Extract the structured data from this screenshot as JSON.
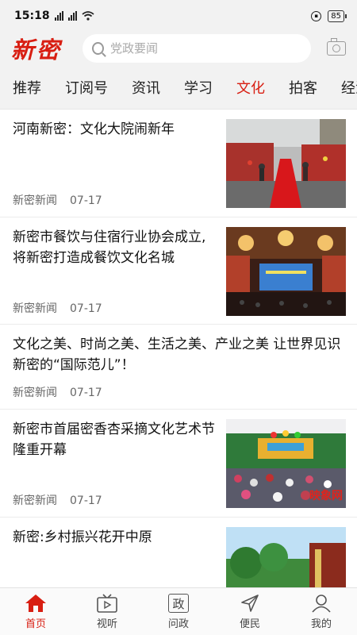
{
  "status_bar": {
    "time": "15:18",
    "battery": "85"
  },
  "header": {
    "logo": "新密",
    "search_placeholder": "党政要闻"
  },
  "tabs": [
    {
      "label": "推荐"
    },
    {
      "label": "订阅号"
    },
    {
      "label": "资讯"
    },
    {
      "label": "学习"
    },
    {
      "label": "文化"
    },
    {
      "label": "拍客"
    },
    {
      "label": "经济"
    }
  ],
  "active_tab": "文化",
  "articles": [
    {
      "title": "河南新密：文化大院闹新年",
      "source": "新密新闻",
      "date": "07-17"
    },
    {
      "title": "新密市餐饮与住宿行业协会成立,将新密打造成餐饮文化名城",
      "source": "新密新闻",
      "date": "07-17"
    },
    {
      "title": "文化之美、时尚之美、生活之美、产业之美 让世界见识新密的“国际范儿”！",
      "source": "新密新闻",
      "date": "07-17"
    },
    {
      "title": "新密市首届密香杏采摘文化艺术节隆重开幕",
      "source": "新密新闻",
      "date": "07-17",
      "watermark": "映象网"
    },
    {
      "title": "新密:乡村振兴花开中原",
      "source": "",
      "date": ""
    }
  ],
  "bottom_nav": [
    {
      "label": "首页",
      "icon": "home-icon"
    },
    {
      "label": "视听",
      "icon": "tv-icon"
    },
    {
      "label": "问政",
      "icon": "zheng-icon",
      "glyph": "政"
    },
    {
      "label": "便民",
      "icon": "send-icon"
    },
    {
      "label": "我的",
      "icon": "profile-icon"
    }
  ],
  "colors": {
    "accent": "#d81e12",
    "bar_bg": "#f2f2f2"
  }
}
